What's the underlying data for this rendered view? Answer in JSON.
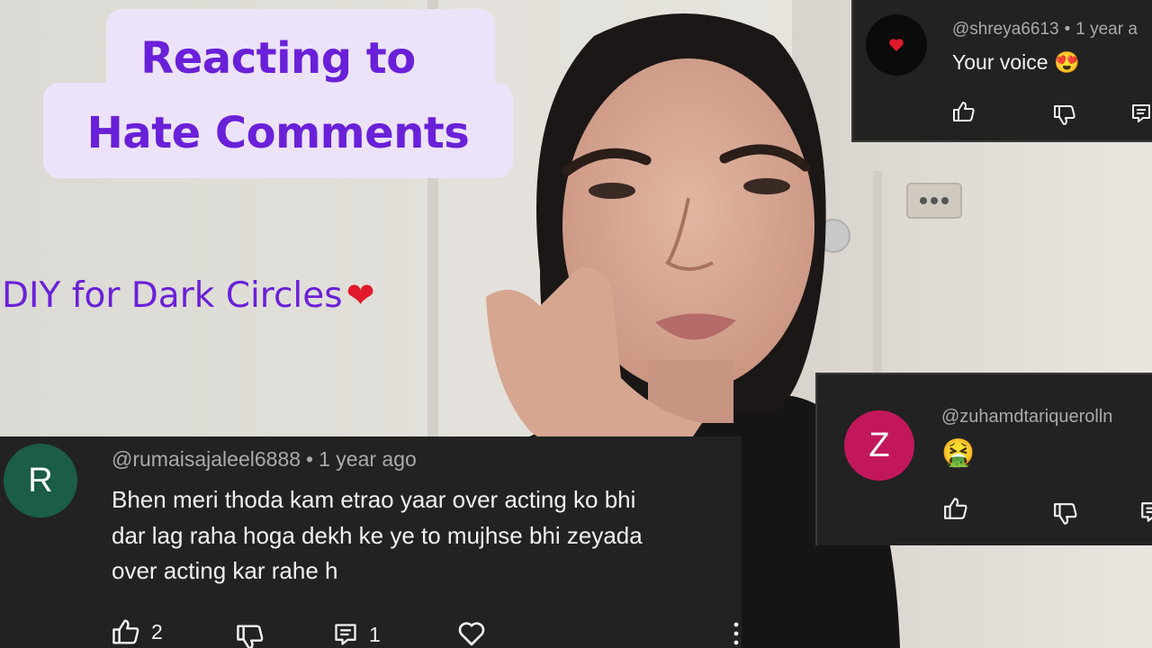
{
  "title": {
    "line1": "Reacting to",
    "line2": "Hate Comments"
  },
  "subtitle": {
    "text": "DIY for Dark Circles",
    "heart": "❤"
  },
  "comments": [
    {
      "avatar_icon": "heart-icon",
      "avatar_bg": "#0b0b0b",
      "username": "@shreya6613",
      "separator": "•",
      "timestamp": "1 year a",
      "text": "Your voice 😍"
    },
    {
      "avatar_letter": "Z",
      "avatar_bg": "#c2185b",
      "username": "@zuhamdtariquerolln",
      "text": "🤮"
    },
    {
      "avatar_letter": "R",
      "avatar_bg": "#1b5e45",
      "username": "@rumaisajaleel6888",
      "separator": "•",
      "timestamp": "1 year ago",
      "text_lines": [
        "Bhen meri thoda kam etrao yaar over acting ko bhi",
        "dar lag raha hoga dekh ke ye to mujhse bhi zeyada",
        "over acting kar rahe h"
      ],
      "like_count": "2",
      "reply_count": "1"
    }
  ],
  "colors": {
    "title_purple": "#6a20d8",
    "title_card_bg": "#ece3fb",
    "heart_red": "#e0192b",
    "comment_card_bg": "#222222",
    "meta_gray": "#aaaaaa"
  }
}
